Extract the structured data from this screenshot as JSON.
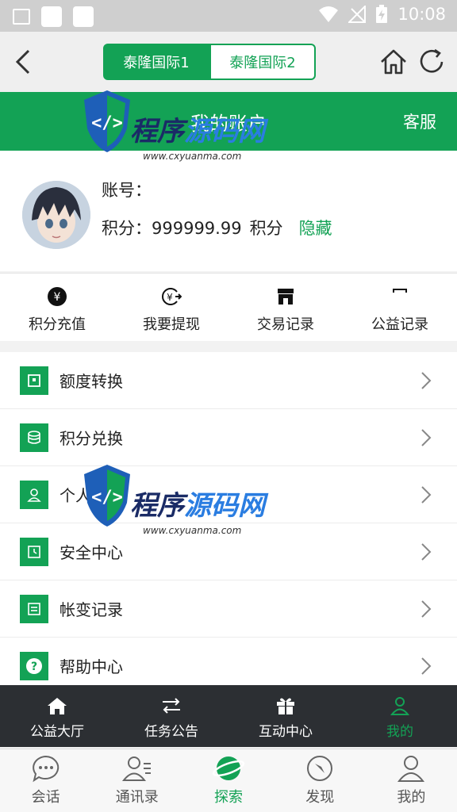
{
  "status_bar": {
    "time": "10:08"
  },
  "top_bar": {
    "segments": [
      "泰隆国际1",
      "泰隆国际2"
    ]
  },
  "header": {
    "title": "我的账户",
    "service": "客服"
  },
  "profile": {
    "account_label": "账号：",
    "points_label": "积分：",
    "points_value": "999999.99",
    "points_unit": "积分",
    "hide_label": "隐藏"
  },
  "actions": [
    {
      "label": "积分充值",
      "icon": "yen-icon"
    },
    {
      "label": "我要提现",
      "icon": "withdraw-icon"
    },
    {
      "label": "交易记录",
      "icon": "shop-icon"
    },
    {
      "label": "公益记录",
      "icon": "record-icon"
    }
  ],
  "menu": [
    {
      "label": "额度转换",
      "icon": "transfer-icon"
    },
    {
      "label": "积分兑换",
      "icon": "coins-icon"
    },
    {
      "label": "个人中心",
      "icon": "user-icon"
    },
    {
      "label": "安全中心",
      "icon": "clock-icon"
    },
    {
      "label": "帐变记录",
      "icon": "document-icon"
    },
    {
      "label": "帮助中心",
      "icon": "help-icon"
    }
  ],
  "tabs_primary": [
    {
      "label": "公益大厅",
      "icon": "home-icon"
    },
    {
      "label": "任务公告",
      "icon": "swap-icon"
    },
    {
      "label": "互动中心",
      "icon": "gift-icon"
    },
    {
      "label": "我的",
      "icon": "user-icon"
    }
  ],
  "tabs_secondary": [
    {
      "label": "会话",
      "icon": "chat-icon"
    },
    {
      "label": "通讯录",
      "icon": "contacts-icon"
    },
    {
      "label": "探索",
      "icon": "planet-icon"
    },
    {
      "label": "发现",
      "icon": "compass-icon"
    },
    {
      "label": "我的",
      "icon": "person-icon"
    }
  ],
  "watermark": {
    "text1": "程序",
    "text2": "源码网",
    "url": "www.cxyuanma.com"
  },
  "colors": {
    "accent": "#13a255",
    "dark_bar": "#2c2f33"
  }
}
